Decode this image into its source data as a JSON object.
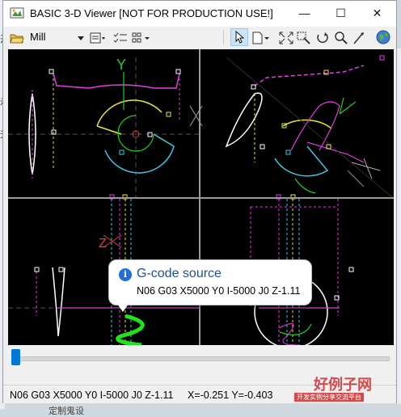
{
  "window": {
    "title": "BASIC 3-D Viewer [NOT FOR PRODUCTION USE!]",
    "controls": {
      "minimize": "—",
      "maximize": "☐",
      "close": "✕"
    }
  },
  "toolbar": {
    "machine_label": "Mill",
    "icons": [
      "open-folder-icon",
      "dropdown-icon",
      "page-setup-icon",
      "checklist-icon",
      "grid-icon",
      "select-arrow-icon",
      "new-page-icon",
      "fit-icon",
      "zoom-window-icon",
      "rotate-icon",
      "zoom-icon",
      "pan-icon",
      "globe-icon"
    ]
  },
  "viewport": {
    "views": [
      "top-left",
      "top-right",
      "bottom-left",
      "bottom-right"
    ],
    "axis_labels": {
      "y": "Y",
      "x": "X",
      "z": "Z"
    }
  },
  "tooltip": {
    "icon": "i",
    "title": "G-code source",
    "body": "N06 G03 X5000 Y0 I-5000 J0 Z-1.11"
  },
  "slider": {
    "position": 0.0
  },
  "status": {
    "gcode": "N06 G03 X5000 Y0 I-5000 J0 Z-1.11",
    "coords": "X=-0.251 Y=-0.403"
  },
  "background": {
    "left_hints": [
      "开",
      "示",
      "天"
    ],
    "bottom_hint": "定制鬼设",
    "watermark_main": "好例子网",
    "watermark_sub": "开发实例分享交流平台"
  },
  "colors": {
    "accent": "#0078d7",
    "viewport_bg": "#000000",
    "path_magenta": "#e040e0",
    "path_cyan": "#40c8e0",
    "path_yellow": "#e8e840",
    "path_green": "#20d020",
    "path_white": "#ffffff"
  }
}
